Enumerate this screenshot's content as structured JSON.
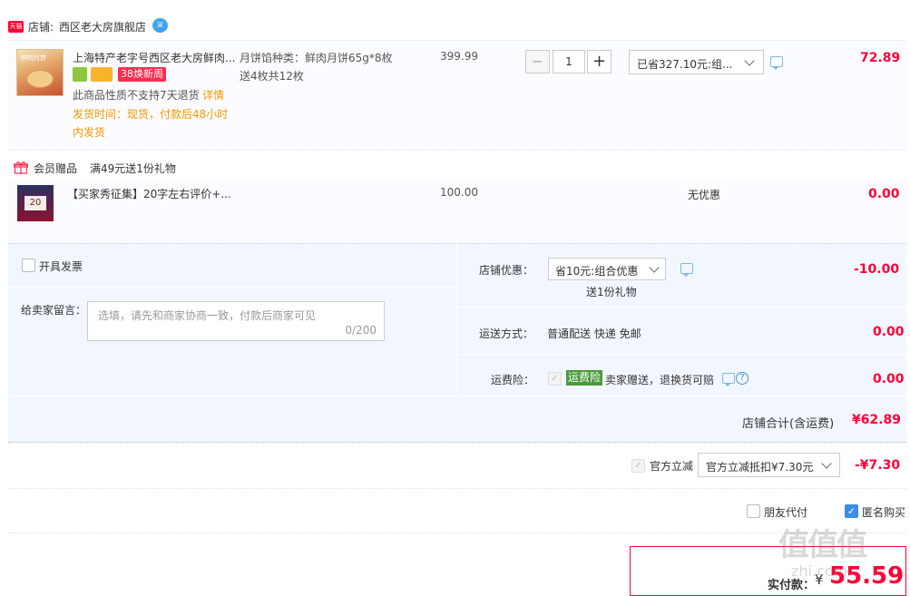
{
  "shop": {
    "badge": "天猫",
    "label": "店铺:",
    "name": "西区老大房旗舰店",
    "wangwang": "ꕤ"
  },
  "item1": {
    "title": "上海特产老字号西区老大房鲜肉...",
    "promo_tag": "38焕新周",
    "notice": "此商品性质不支持7天退货",
    "detail_link": "详情",
    "ship_line1": "发货时间：现货，付款后48小时",
    "ship_line2": "内发货",
    "sku_line1": "月饼馅种类：鲜肉月饼65g*8枚",
    "sku_line2": "送4枚共12枚",
    "price": "399.99",
    "qty": "1",
    "minus": "−",
    "plus": "+",
    "discount_select": "已省327.10元:组...",
    "subtotal": "72.89",
    "thumb_mini_text": "鲜肉月饼"
  },
  "gift": {
    "label": "会员赠品",
    "condition": "满49元送1份礼物",
    "title": "【买家秀征集】20字左右评价+...",
    "price": "100.00",
    "promo": "无优惠",
    "subtotal": "0.00",
    "thumb_number": "20"
  },
  "options": {
    "invoice_label": "开具发票",
    "message_label": "给卖家留言：",
    "message_placeholder": "选填，请先和商家协商一致，付款后商家可见",
    "message_count": "0/200",
    "shop_discount_label": "店铺优惠：",
    "shop_discount_select": "省10元:组合优惠",
    "shop_discount_sub": "送1份礼物",
    "shop_discount_amount": "-10.00",
    "delivery_label": "运送方式：",
    "delivery_value": "普通配送 快递 免邮",
    "delivery_amount": "0.00",
    "insurance_label": "运费险：",
    "insurance_badge": "运费险",
    "insurance_text": "卖家赠送，退换货可赔",
    "insurance_amount": "0.00",
    "help": "?"
  },
  "total": {
    "label": "店铺合计(含运费)",
    "value": "¥62.89"
  },
  "official": {
    "label": "官方立减",
    "select": "官方立减抵扣¥7.30元",
    "amount": "-¥7.30"
  },
  "pay": {
    "friend_label": "朋友代付",
    "anon_label": "匿名购买",
    "checkmark": "✓",
    "final_label": "实付款：",
    "currency": "¥",
    "final_value": "55.59"
  },
  "watermark": {
    "main": "值值值",
    "sub": "zhi.com"
  }
}
